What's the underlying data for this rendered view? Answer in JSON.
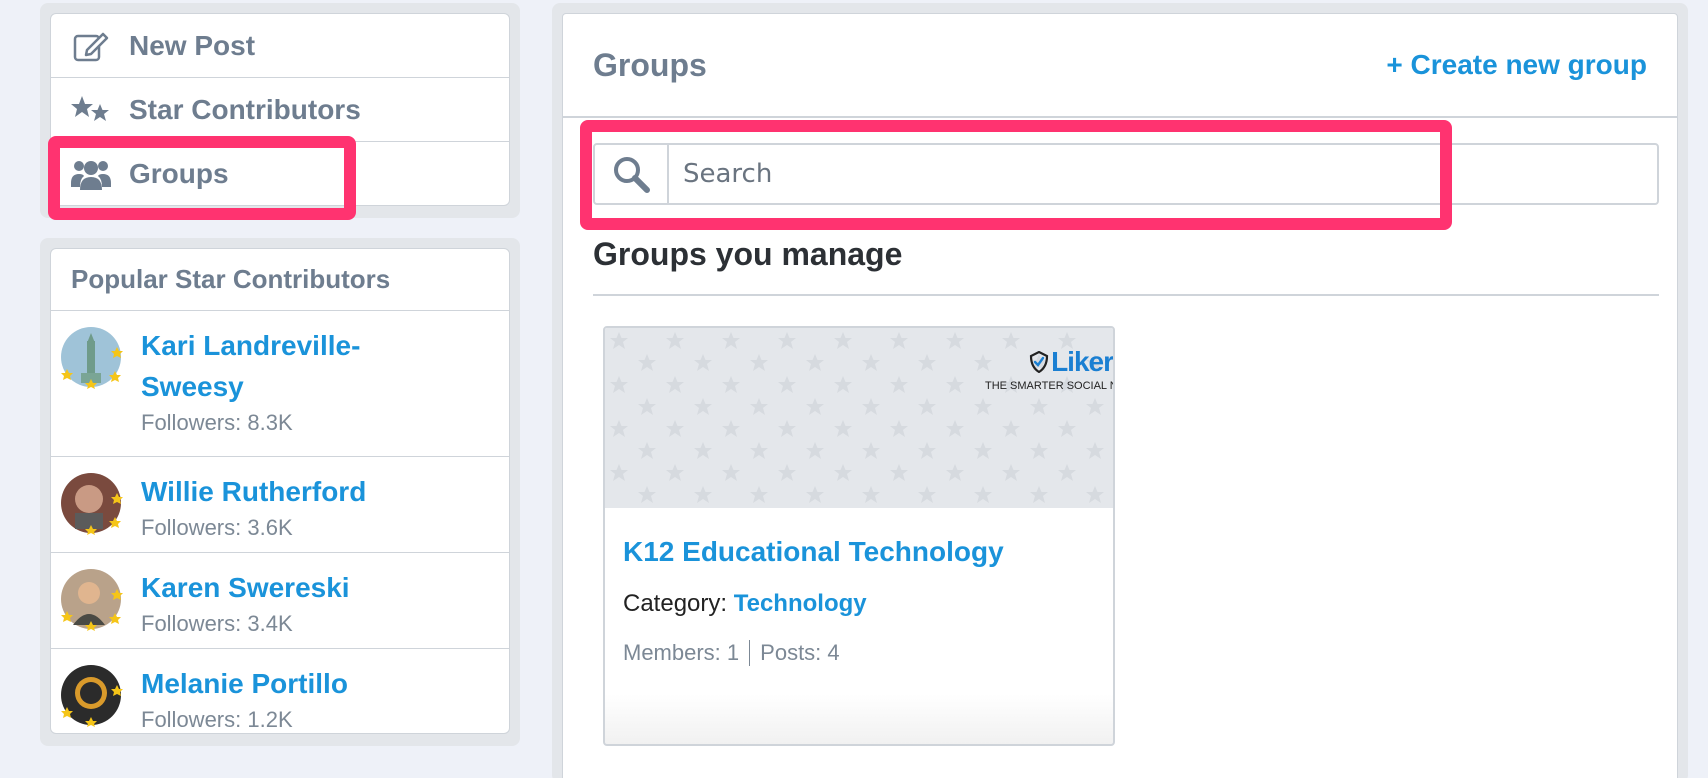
{
  "nav": {
    "items": [
      {
        "label": "New Post",
        "icon": "edit-icon"
      },
      {
        "label": "Star Contributors",
        "icon": "stars-icon"
      },
      {
        "label": "Groups",
        "icon": "users-icon"
      }
    ]
  },
  "contributors": {
    "title": "Popular Star Contributors",
    "items": [
      {
        "name": "Kari Landreville-Sweesy",
        "followers": "Followers: 8.3K"
      },
      {
        "name": "Willie Rutherford",
        "followers": "Followers: 3.6K"
      },
      {
        "name": "Karen Swereski",
        "followers": "Followers: 3.4K"
      },
      {
        "name": "Melanie Portillo",
        "followers": "Followers: 1.2K"
      }
    ]
  },
  "main": {
    "title": "Groups",
    "create_label": "+ Create new group",
    "search_placeholder": "Search",
    "section_title": "Groups you manage",
    "group_card": {
      "logo_word": "Liker",
      "logo_tagline": "THE SMARTER SOCIAL NETWORK",
      "name": "K12 Educational Technology",
      "category_label": "Category:",
      "category_value": "Technology",
      "members": "Members: 1",
      "posts": "Posts: 4"
    }
  },
  "colors": {
    "accent": "#1a93da",
    "muted": "#6e7d8f",
    "highlight": "#ff3370"
  }
}
